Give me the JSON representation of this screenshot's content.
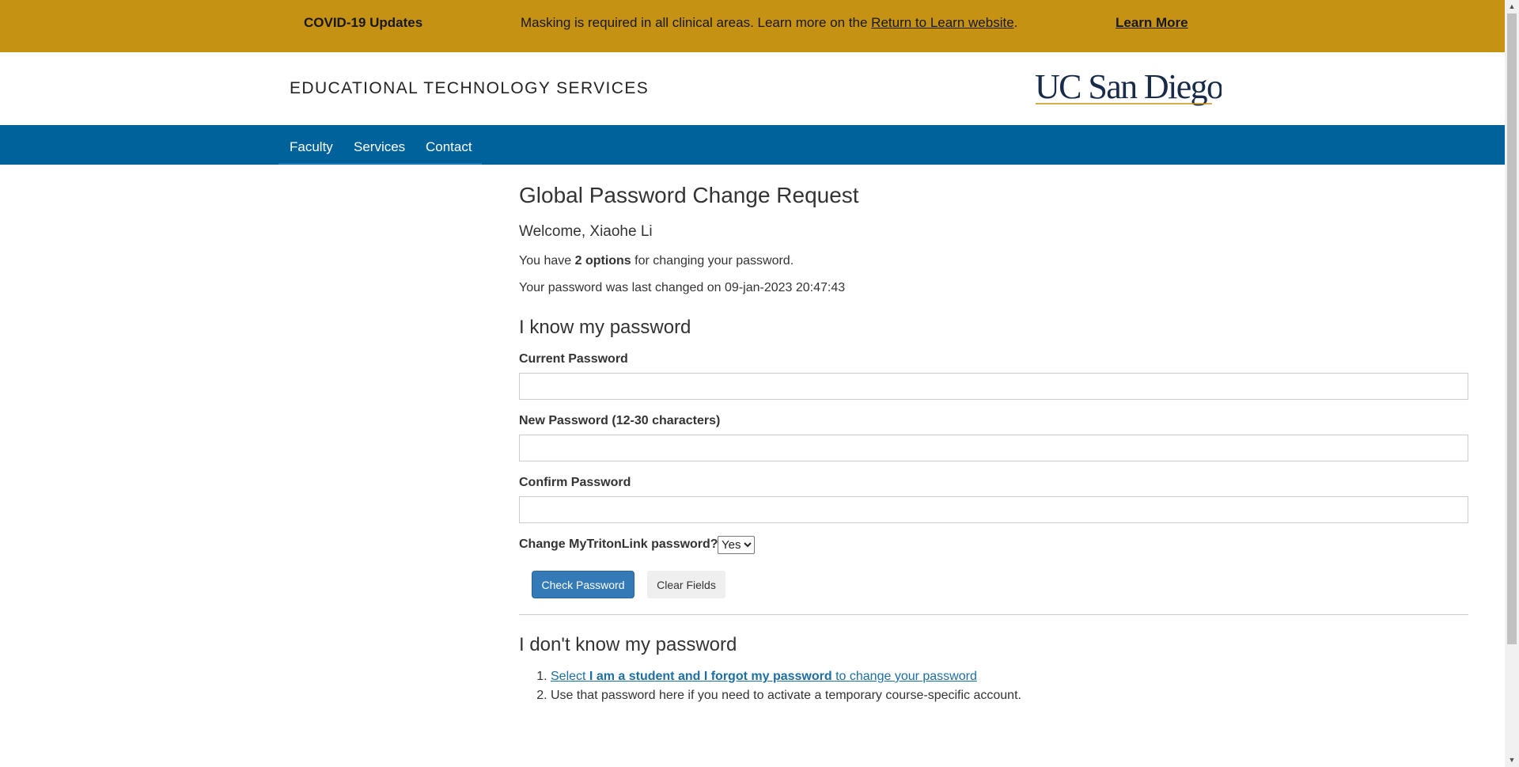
{
  "covid": {
    "title": "COVID-19 Updates",
    "message_prefix": "Masking is required in all clinical areas. Learn more on the ",
    "message_link": "Return to Learn website",
    "message_suffix": ".",
    "learn_more": "Learn More",
    "bar_color": "#c69214"
  },
  "header": {
    "site_title": "EDUCATIONAL TECHNOLOGY SERVICES",
    "logo_text": "UC San Diego"
  },
  "nav": {
    "items": [
      "Faculty",
      "Services",
      "Contact"
    ],
    "bar_color": "#00629b"
  },
  "page": {
    "title": "Global Password Change Request",
    "welcome": "Welcome, Xiaohe Li",
    "options_prefix": "You have ",
    "options_bold": "2 options",
    "options_suffix": " for changing your password.",
    "last_changed": "Your password was last changed on 09-jan-2023 20:47:43"
  },
  "known": {
    "heading": "I know my password",
    "current_label": "Current Password",
    "current_value": "",
    "new_label": "New Password (12-30 characters)",
    "new_value": "",
    "confirm_label": "Confirm Password",
    "confirm_value": "",
    "mytritonlink_label": "Change MyTritonLink password?",
    "mytritonlink_selected": "Yes",
    "check_button": "Check Password",
    "clear_button": "Clear Fields"
  },
  "unknown": {
    "heading": "I don't know my password",
    "step1_prefix": "Select ",
    "step1_bold": "I am a student and I forgot my password",
    "step1_suffix": " to change your password",
    "step2": "Use that password here if you need to activate a temporary course-specific account."
  },
  "colors": {
    "primary_button": "#337ab7",
    "link": "#1c6ea4",
    "logo_navy": "#182b49",
    "logo_gold": "#c69214"
  },
  "icons": {
    "scroll_up": "arrow-up-icon",
    "scroll_down": "arrow-down-icon",
    "select_arrow": "chevron-down-icon"
  }
}
